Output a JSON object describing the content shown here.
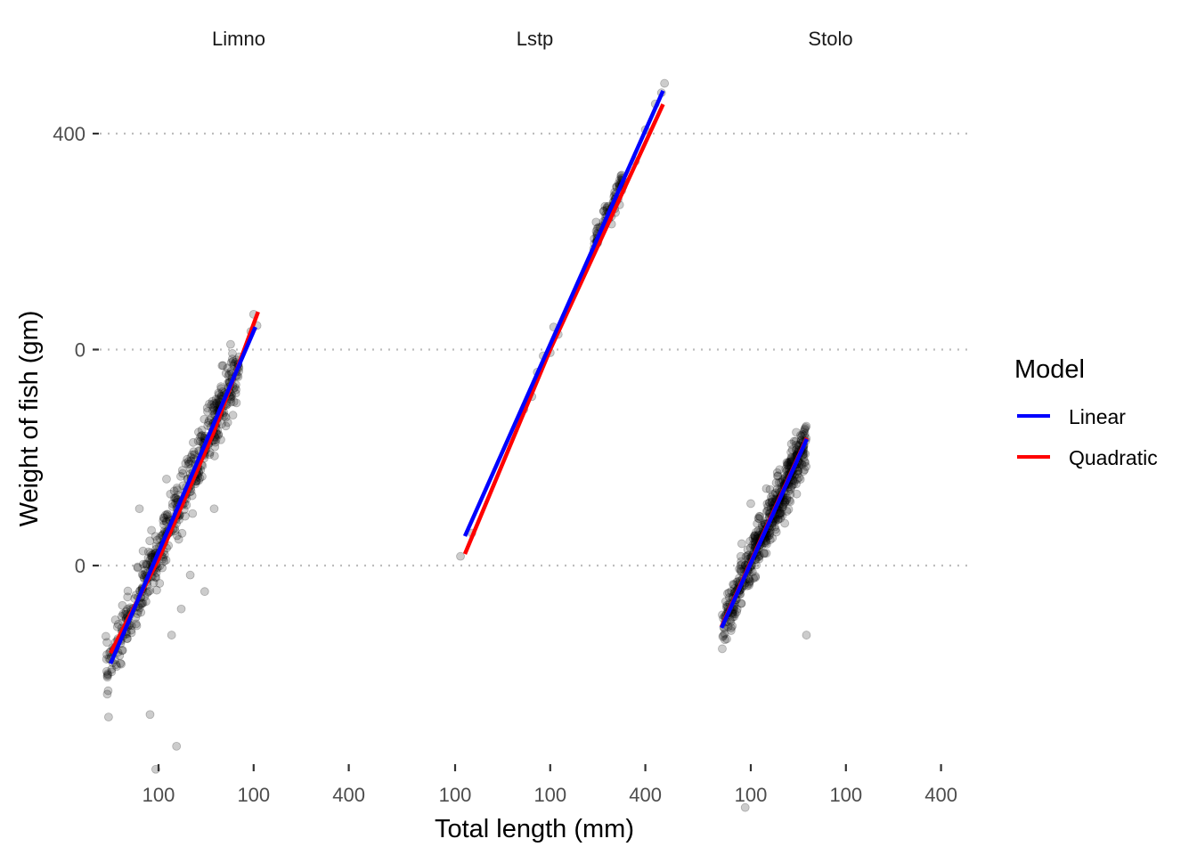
{
  "chart_data": {
    "type": "scatter",
    "title": "",
    "xlabel": "Total length (mm)",
    "ylabel": "Weight of fish (gm)",
    "x_scale": "log",
    "y_scale": "log",
    "grid": "horizontal-major-dotted",
    "legend_position": "right",
    "y_ticks": [
      {
        "value": 100,
        "label": "0"
      },
      {
        "value": 200,
        "label": "0"
      },
      {
        "value": 400,
        "label": "400"
      }
    ],
    "ylim": [
      48,
      620
    ],
    "legend": {
      "title": "Model",
      "entries": [
        {
          "name": "Linear",
          "color": "#0000ff"
        },
        {
          "name": "Quadratic",
          "color": "#ff0000"
        }
      ]
    },
    "point_style": {
      "fill": "#000000",
      "opacity": 0.2
    },
    "panels": [
      {
        "name": "Limno",
        "x_ticks": [
          {
            "value": 100,
            "label": "100"
          },
          {
            "value": 200,
            "label": "100"
          },
          {
            "value": 400,
            "label": "400"
          }
        ],
        "xlim": [
          64,
          520
        ],
        "cluster": {
          "x_range": [
            68,
            180
          ],
          "n_points": 500,
          "slope_log": 1.08,
          "spread_log": 0.045
        },
        "outliers": [
          [
            98,
            52
          ],
          [
            114,
            56
          ],
          [
            94,
            62
          ],
          [
            118,
            87
          ],
          [
            140,
            92
          ],
          [
            126,
            97
          ],
          [
            106,
            132
          ],
          [
            95,
            112
          ],
          [
            87,
            120
          ],
          [
            150,
            120
          ],
          [
            73,
            84
          ],
          [
            110,
            80
          ],
          [
            160,
            190
          ],
          [
            200,
            224
          ],
          [
            205,
            216
          ],
          [
            196,
            212
          ]
        ],
        "fits": {
          "Linear": [
            [
              70.5,
              73
            ],
            [
              202.6,
              215
            ]
          ],
          "Quadratic": [
            [
              70.5,
              75.5
            ],
            [
              100,
              102
            ],
            [
              150,
              154
            ],
            [
              206.6,
              225.8
            ]
          ]
        }
      },
      {
        "name": "Lstp",
        "x_ticks": [
          {
            "value": 100,
            "label": "100"
          },
          {
            "value": 200,
            "label": "100"
          },
          {
            "value": 400,
            "label": "400"
          }
        ],
        "xlim": [
          64,
          520
        ],
        "cluster": {
          "x_range": [
            270,
            340
          ],
          "n_points": 80,
          "slope_log": 1.0,
          "spread_log": 0.02
        },
        "outliers": [
          [
            104,
            103
          ],
          [
            113,
            111
          ],
          [
            165,
            165
          ],
          [
            175,
            172
          ],
          [
            182,
            186
          ],
          [
            190,
            196
          ],
          [
            200,
            198
          ],
          [
            212,
            210
          ],
          [
            205,
            215
          ],
          [
            400,
            405
          ],
          [
            430,
            440
          ],
          [
            450,
            456
          ],
          [
            460,
            470
          ],
          [
            372,
            366
          ]
        ],
        "fits": {
          "Linear": [
            [
              107.4,
              109.9
            ],
            [
              455,
              459
            ]
          ],
          "Quadratic": [
            [
              107.4,
              103.8
            ],
            [
              200,
              200
            ],
            [
              455,
              439.5
            ]
          ]
        }
      },
      {
        "name": "Stolo",
        "x_ticks": [
          {
            "value": 100,
            "label": "100"
          },
          {
            "value": 200,
            "label": "100"
          },
          {
            "value": 400,
            "label": "400"
          }
        ],
        "xlim": [
          64,
          520
        ],
        "cluster": {
          "x_range": [
            81,
            150
          ],
          "n_points": 500,
          "slope_log": 1.0,
          "spread_log": 0.04
        },
        "outliers": [
          [
            96,
            46
          ],
          [
            150,
            80
          ],
          [
            82,
            82
          ],
          [
            86,
            84
          ],
          [
            100,
            122
          ],
          [
            102,
            96
          ],
          [
            112,
            128
          ],
          [
            93,
            103
          ],
          [
            107,
            117
          ],
          [
            148,
            136
          ],
          [
            141,
            142
          ]
        ],
        "fits": {
          "Linear": [
            [
              80.8,
              81.9
            ],
            [
              150.4,
              150.1
            ]
          ],
          "Quadratic": [
            [
              80.8,
              82.2
            ],
            [
              115,
              116
            ],
            [
              150.4,
              150.6
            ]
          ]
        }
      }
    ]
  }
}
